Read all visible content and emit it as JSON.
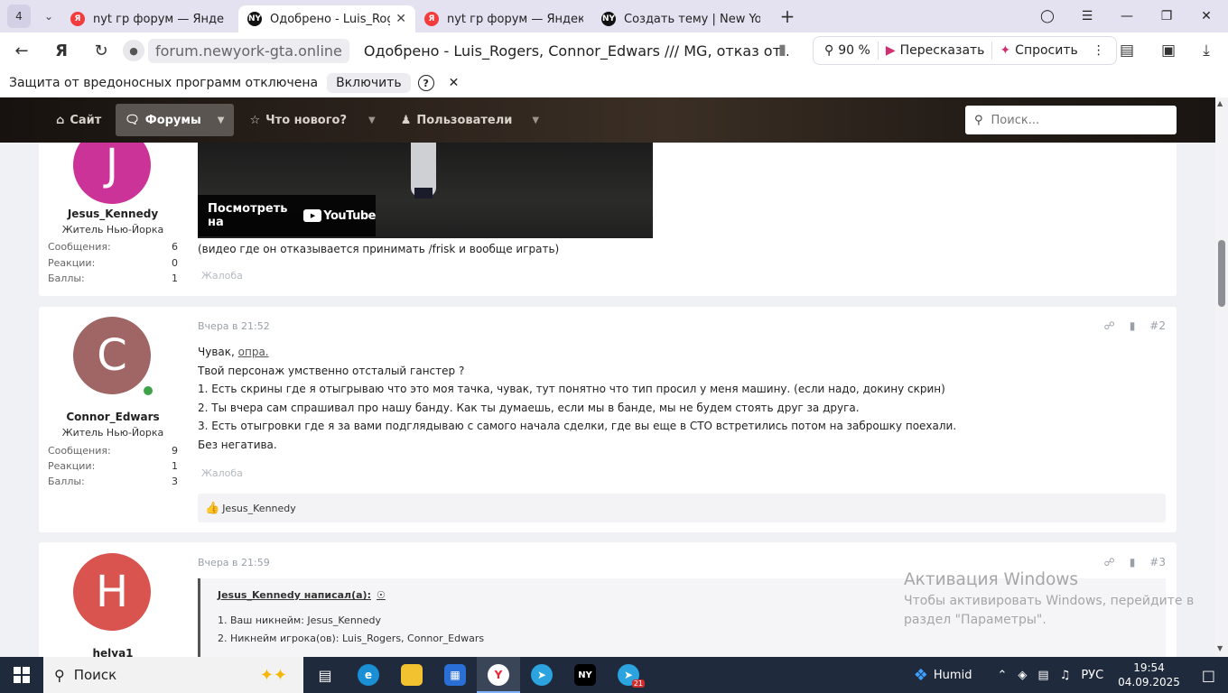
{
  "browser": {
    "tab_count": "4",
    "tabs": [
      {
        "title": "nyt гр форум — Яндекс: н",
        "favicon": "yandex-icon",
        "active": false
      },
      {
        "title": "Одобрено - Luis_Rogers",
        "favicon": "ny-icon",
        "active": true
      },
      {
        "title": "nyt гр форум — Яндекс: н",
        "favicon": "yandex-icon",
        "active": false
      },
      {
        "title": "Создать тему | New York",
        "favicon": "ny-icon",
        "active": false
      }
    ],
    "domain": "forum.newyork-gta.online",
    "page_title": "Одобрено - Luis_Rogers, Connor_Edwars /// MG, отказ от...",
    "zoom": "90 %",
    "retell_label": "Пересказать",
    "ask_label": "Спросить"
  },
  "infobar": {
    "message": "Защита от вредоносных программ отключена",
    "enable_label": "Включить"
  },
  "forum_nav": {
    "items": [
      "Сайт",
      "Форумы",
      "Что нового?",
      "Пользователи"
    ],
    "search_placeholder": "Поиск..."
  },
  "posts": [
    {
      "avatar_letter": "J",
      "avatar_color": "#cc3399",
      "username": "Jesus_Kennedy",
      "user_title": "Житель Нью-Йорка",
      "stats": [
        {
          "label": "Сообщения:",
          "value": "6"
        },
        {
          "label": "Реакции:",
          "value": "0"
        },
        {
          "label": "Баллы:",
          "value": "1"
        }
      ],
      "video_watch_label": "Посмотреть на",
      "video_brand": "YouTube",
      "caption": "(видео где он отказывается принимать /frisk и вообще играть)",
      "report_label": "Жалоба"
    },
    {
      "avatar_letter": "C",
      "avatar_color": "#a06666",
      "username": "Connor_Edwars",
      "user_title": "Житель Нью-Йорка",
      "stats": [
        {
          "label": "Сообщения:",
          "value": "9"
        },
        {
          "label": "Реакции:",
          "value": "1"
        },
        {
          "label": "Баллы:",
          "value": "3"
        }
      ],
      "date": "Вчера в 21:52",
      "number": "#2",
      "line0_prefix": "Чувак, ",
      "line0_link": "опра.",
      "lines": [
        "Твой персонаж умственно отсталый ганстер ?",
        "1. Есть скрины где я отыгрываю что это моя тачка, чувак, тут понятно что тип просил у меня машину. (если надо, докину скрин)",
        "2. Ты вчера сам спрашивал про нашу банду. Как ты думаешь, если мы в банде, мы не будем стоять друг за друга.",
        "3. Есть отыгровки где я за вами подглядываю с самого начала сделки, где вы еще в СТО встретились потом на заброшку поехали.",
        "Без негатива."
      ],
      "report_label": "Жалоба",
      "likes": "Jesus_Kennedy"
    },
    {
      "avatar_letter": "H",
      "avatar_color": "#d9534f",
      "username": "helya1",
      "date": "Вчера в 21:59",
      "number": "#3",
      "quote_author": "Jesus_Kennedy написал(а):",
      "quote_lines": [
        "1. Ваш никнейм: Jesus_Kennedy",
        "2. Никнейм игрока(ов): Luis_Rogers, Connor_Edwars"
      ]
    }
  ],
  "watermark": {
    "title": "Активация Windows",
    "line1": "Чтобы активировать Windows, перейдите в",
    "line2": "раздел \"Параметры\"."
  },
  "taskbar": {
    "search_label": "Поиск",
    "weather": "Humid",
    "lang": "РУС",
    "time": "19:54",
    "date": "04.09.2025",
    "telegram_badge": "21"
  }
}
